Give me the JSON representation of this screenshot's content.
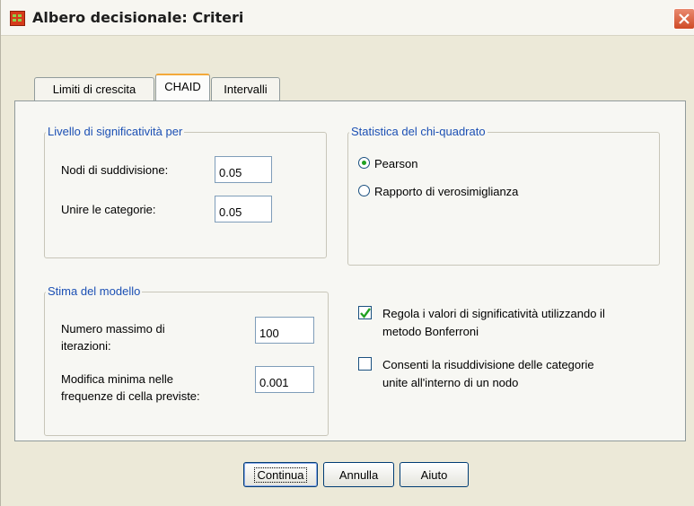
{
  "window": {
    "title": "Albero decisionale: Criteri"
  },
  "tabs": [
    {
      "label": "Limiti di crescita",
      "active": false
    },
    {
      "label": "CHAID",
      "active": true
    },
    {
      "label": "Intervalli",
      "active": false
    }
  ],
  "significance_group": {
    "title": "Livello di significatività per",
    "split_nodes_label": "Nodi di suddivisione:",
    "split_nodes_value": "0.05",
    "merge_categories_label": "Unire le categorie:",
    "merge_categories_value": "0.05"
  },
  "chi_square_group": {
    "title": "Statistica del chi-quadrato",
    "options": [
      {
        "label": "Pearson",
        "selected": true
      },
      {
        "label": "Rapporto di verosimiglianza",
        "selected": false
      }
    ]
  },
  "model_estimation_group": {
    "title": "Stima del modello",
    "max_iterations_label_line1": "Numero massimo di",
    "max_iterations_label_line2": "iterazioni:",
    "max_iterations_value": "100",
    "min_change_label_line1": "Modifica minima nelle",
    "min_change_label_line2": "frequenze di cella previste:",
    "min_change_value": "0.001"
  },
  "options": {
    "bonferroni_line1": "Regola i valori di significatività utilizzando il",
    "bonferroni_line2": "metodo Bonferroni",
    "bonferroni_checked": true,
    "resplit_line1": "Consenti la risuddivisione delle categorie",
    "resplit_line2": "unite all'interno di un nodo",
    "resplit_checked": false
  },
  "buttons": {
    "continue": "Continua",
    "cancel": "Annulla",
    "help": "Aiuto"
  },
  "colors": {
    "group_title": "#1c50b4",
    "tab_active_accent": "#f3a93a",
    "radio_dot": "#21a121",
    "check_mark": "#21a121"
  }
}
